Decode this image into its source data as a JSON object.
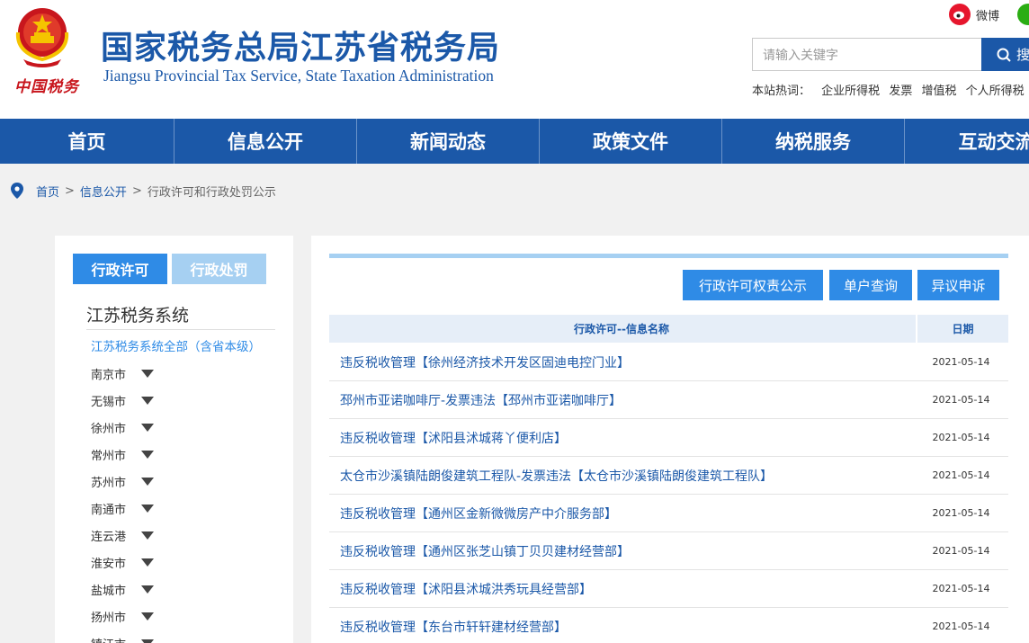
{
  "header": {
    "title": "国家税务总局江苏省税务局",
    "subtitle": "Jiangsu Provincial Tax Service, State Taxation Administration",
    "brand_script": "中国税务",
    "weibo_label": "微博",
    "search_placeholder": "请输入关键字",
    "search_button": "搜",
    "hot_label": "本站热词：",
    "hot_words": [
      "企业所得税",
      "发票",
      "增值税",
      "个人所得税"
    ]
  },
  "nav": {
    "items": [
      "首页",
      "信息公开",
      "新闻动态",
      "政策文件",
      "纳税服务",
      "互动交流"
    ]
  },
  "breadcrumb": {
    "items": [
      "首页",
      "信息公开",
      "行政许可和行政处罚公示"
    ]
  },
  "left": {
    "tabs": [
      "行政许可",
      "行政处罚"
    ],
    "section_title": "江苏税务系统",
    "all_link": "江苏税务系统全部（含省本级）",
    "cities": [
      "南京市",
      "无锡市",
      "徐州市",
      "常州市",
      "苏州市",
      "南通市",
      "连云港",
      "淮安市",
      "盐城市",
      "扬州市",
      "镇江市"
    ]
  },
  "main": {
    "buttons": [
      "行政许可权责公示",
      "单户查询",
      "异议申诉"
    ],
    "columns": [
      "行政许可--信息名称",
      "日期"
    ],
    "rows": [
      {
        "title": "违反税收管理【徐州经济技术开发区固迪电控门业】",
        "date": "2021-05-14"
      },
      {
        "title": "邳州市亚诺咖啡厅-发票违法【邳州市亚诺咖啡厅】",
        "date": "2021-05-14"
      },
      {
        "title": "违反税收管理【沭阳县沭城蒋丫便利店】",
        "date": "2021-05-14"
      },
      {
        "title": "太仓市沙溪镇陆朗俊建筑工程队-发票违法【太仓市沙溪镇陆朗俊建筑工程队】",
        "date": "2021-05-14"
      },
      {
        "title": "违反税收管理【通州区金新微微房产中介服务部】",
        "date": "2021-05-14"
      },
      {
        "title": "违反税收管理【通州区张芝山镇丁贝贝建材经营部】",
        "date": "2021-05-14"
      },
      {
        "title": "违反税收管理【沭阳县沭城洪秀玩具经营部】",
        "date": "2021-05-14"
      },
      {
        "title": "违反税收管理【东台市轩轩建材经营部】",
        "date": "2021-05-14"
      }
    ]
  },
  "colors": {
    "brand_blue": "#1b58a8",
    "accent_blue": "#2f8be6",
    "light_blue": "#a6d0f2",
    "emblem_red": "#c8161d"
  }
}
